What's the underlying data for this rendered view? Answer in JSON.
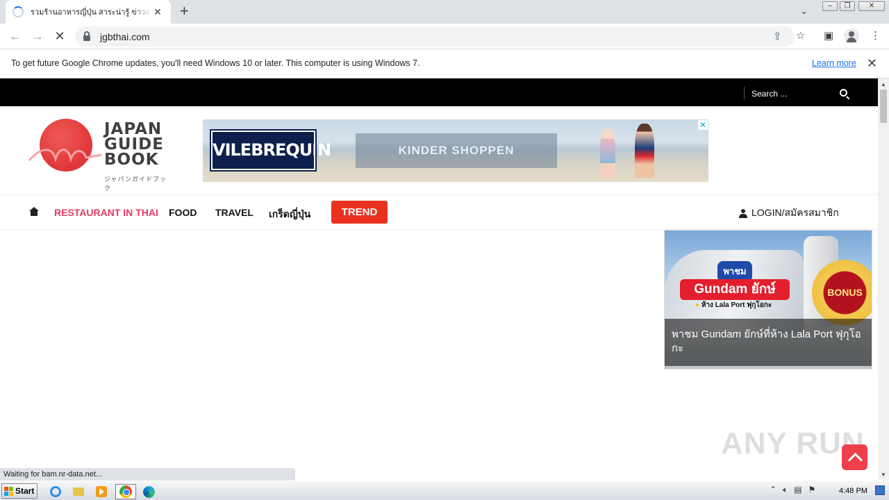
{
  "browser": {
    "tab_title": "รวมร้านอาหารญี่ปุ่น สาระน่ารู้ ข่าวสาร อ",
    "tab_close": "✕",
    "new_tab": "+",
    "url": "jgbthai.com"
  },
  "infobar": {
    "message": "To get future Google Chrome updates, you'll need Windows 10 or later. This computer is using Windows 7.",
    "learn_more": "Learn more",
    "close": "✕"
  },
  "site": {
    "search_placeholder": "Search ...",
    "logo": {
      "line1": "JAPAN",
      "line2": "GUIDE",
      "line3": "BOOK",
      "sub": "ジャパンガイドブック"
    },
    "ad": {
      "brand": "VILEBREQUIN",
      "cta": "KINDER SHOPPEN",
      "close": "✕"
    },
    "nav": {
      "items": [
        "RESTAURANT IN THAI",
        "FOOD",
        "TRAVEL",
        "เกร็ดญี่ปุ่น"
      ],
      "trend": "TREND",
      "login": "LOGIN/สมัครสมาชิก"
    },
    "card": {
      "pill": "พาชม",
      "title_label": "Gundam ยักษ์",
      "place": "ห้าง Lala Port ฟุกุโอกะ",
      "bonus": "BONUS",
      "caption": "พาชม Gundam ยักษ์ที่ห้าง Lala Port ฟุกุโอกะ"
    }
  },
  "status": "Waiting for bam.nr-data.net...",
  "watermark": "ANY RUN",
  "taskbar": {
    "start": "Start",
    "time": "4:48 PM"
  },
  "colors": {
    "accent_pink": "#e83a5f",
    "trend_red": "#e8321f",
    "top_button": "#ee3f4b"
  }
}
